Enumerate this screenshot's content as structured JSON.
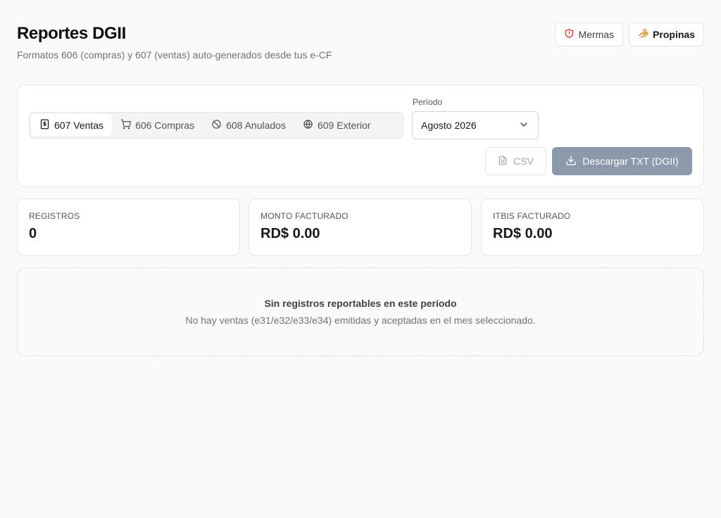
{
  "header": {
    "title": "Reportes DGII",
    "subtitle": "Formatos 606 (compras) y 607 (ventas) auto-generados desde tus e-CF",
    "actions": [
      {
        "label": "Mermas",
        "icon": "shield-alert-icon",
        "icon_color": "#dc2626"
      },
      {
        "label": "Propinas",
        "icon": "coins-icon",
        "icon_color": "#d97706"
      }
    ]
  },
  "filters": {
    "tabs": [
      {
        "label": "607 Ventas",
        "icon": "receipt-icon",
        "active": true
      },
      {
        "label": "606 Compras",
        "icon": "cart-icon",
        "active": false
      },
      {
        "label": "608 Anulados",
        "icon": "ban-icon",
        "active": false
      },
      {
        "label": "609 Exterior",
        "icon": "globe-icon",
        "active": false
      }
    ],
    "period_label": "Período",
    "period_value": "Agosto 2026",
    "csv_label": "CSV",
    "txt_label": "Descargar TXT (DGII)"
  },
  "stats": [
    {
      "label": "REGISTROS",
      "value": "0"
    },
    {
      "label": "MONTO FACTURADO",
      "value": "RD$ 0.00"
    },
    {
      "label": "ITBIS FACTURADO",
      "value": "RD$ 0.00"
    }
  ],
  "empty_state": {
    "title": "Sin registros reportables en este período",
    "description": "No hay ventas (e31/e32/e33/e34) emitidas y aceptadas en el mes seleccionado."
  },
  "colors": {
    "background": "#fafafa",
    "primary_disabled": "#8c99ab",
    "mermas_icon": "#dc2626",
    "propinas_icon": "#d97706"
  }
}
